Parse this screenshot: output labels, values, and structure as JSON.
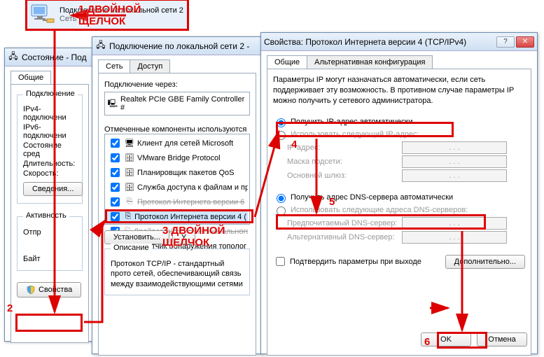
{
  "adapter": {
    "name": "Подключение по локальной сети 2",
    "subtitle": "Сеть"
  },
  "annotations": {
    "a1": "1 ДВОЙНОЙ ЩЕЛЧОК",
    "a2": "2",
    "a3": "3 ДВОЙНОЙ ЩЕЛЧОК",
    "a4": "4",
    "a5": "5",
    "a6": "6"
  },
  "win1": {
    "title": "Состояние - Под",
    "tab_general": "Общие",
    "grp_connection": "Подключение",
    "ipv4": "IPv4-подключени",
    "ipv6": "IPv6-подключени",
    "media": "Состояние сред",
    "duration": "Длительность:",
    "speed": "Скорость:",
    "details_btn": "Сведения...",
    "grp_activity": "Активность",
    "sent": "Отпр",
    "bytes": "Байт",
    "properties_btn": "Свойства"
  },
  "win2": {
    "title": "Подключение по локальной сети 2 - ",
    "tab_net": "Сеть",
    "tab_access": "Доступ",
    "connect_via": "Подключение через:",
    "adapter": "Realtek PCIe GBE Family Controller #",
    "components_label": "Отмеченные компоненты используются",
    "components": [
      "Клиент для сетей Microsoft",
      "VMware Bridge Protocol",
      "Планировщик пакетов QoS",
      "Служба доступа к файлам и при",
      "Протокол Интернета версии 6",
      "Протокол Интернета версии 4 (",
      "Драйвер в/в тополог. канального",
      "Ответчик обнаружения тополог"
    ],
    "install_btn": "Установить...",
    "uninstall_btn": "У",
    "grp_description": "Описание",
    "description": "Протокол TCP/IP - стандартный прото сетей, обеспечивающий связь между взаимодействующими сетями"
  },
  "win3": {
    "title": "Свойства: Протокол Интернета версии 4 (TCP/IPv4)",
    "tab_general": "Общие",
    "tab_alt": "Альтернативная конфигурация",
    "intro": "Параметры IP могут назначаться автоматически, если сеть поддерживает эту возможность. В противном случае параметры IP можно получить у сетевого администратора.",
    "radio_ip_auto": "Получить IP-адрес автоматически",
    "radio_ip_manual": "Использовать следующий IP-адрес:",
    "ip_address": "IP-адрес:",
    "mask": "Маска подсети:",
    "gateway": "Основной шлюз:",
    "radio_dns_auto": "Получить адрес DNS-сервера автоматически",
    "radio_dns_manual": "Использовать следующие адреса DNS-серверов:",
    "dns_pref": "Предпочитаемый DNS-сервер:",
    "dns_alt": "Альтернативный DNS-сервер:",
    "validate": "Подтвердить параметры при выходе",
    "advanced_btn": "Дополнительно...",
    "ok_btn": "OK",
    "cancel_btn": "Отмена",
    "ip_dots": ".       .       ."
  }
}
